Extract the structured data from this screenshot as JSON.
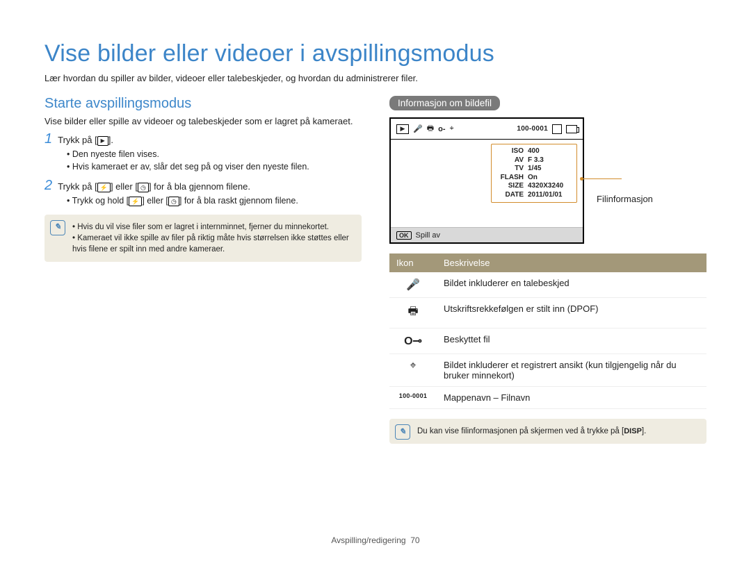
{
  "title": "Vise bilder eller videoer i avspillingsmodus",
  "intro": "Lær hvordan du spiller av bilder, videoer eller talebeskjeder, og hvordan du administrerer filer.",
  "left": {
    "heading": "Starte avspillingsmodus",
    "p1": "Vise bilder eller spille av videoer og talebeskjeder som er lagret på kameraet.",
    "step1_pre": "Trykk på [",
    "step1_post": "].",
    "step1_b1": "Den nyeste filen vises.",
    "step1_b2": "Hvis kameraet er av, slår det seg på og viser den nyeste filen.",
    "step2_pre": "Trykk på [",
    "step2_mid": "] eller [",
    "step2_post": "] for å bla gjennom filene.",
    "step2_sub_pre": "Trykk og hold [",
    "step2_sub_mid": "] eller [",
    "step2_sub_post": "] for å bla raskt gjennom filene.",
    "note1": "Hvis du vil vise filer som er lagret i internminnet, fjerner du minnekortet.",
    "note2": "Kameraet vil ikke spille av filer på riktig måte hvis størrelsen ikke støttes eller hvis filene er spilt inn med andre kameraer."
  },
  "right": {
    "label": "Informasjon om bildefil",
    "filenum": "100-0001",
    "info_label": "Filinformasjon",
    "info_rows": [
      {
        "k": "ISO",
        "v": "400"
      },
      {
        "k": "AV",
        "v": "F 3.3"
      },
      {
        "k": "TV",
        "v": "1/45"
      },
      {
        "k": "FLASH",
        "v": "On"
      },
      {
        "k": "SIZE",
        "v": "4320X3240"
      },
      {
        "k": "DATE",
        "v": "2011/01/01"
      }
    ],
    "ok_label": "OK",
    "play_label": "Spill av",
    "table_hdr_icon": "Ikon",
    "table_hdr_desc": "Beskrivelse",
    "rows": [
      {
        "icon": "🎤",
        "icon_name": "voice-icon",
        "desc": "Bildet inkluderer en talebeskjed"
      },
      {
        "icon": "🖶",
        "icon_name": "print-icon",
        "desc": "Utskriftsrekkefølgen er stilt inn (DPOF)"
      },
      {
        "icon": "🗝",
        "icon_name": "lock-icon",
        "desc": "Beskyttet fil"
      },
      {
        "icon": "⌖",
        "icon_name": "face-icon",
        "desc": "Bildet inkluderer et registrert ansikt (kun tilgjengelig når du bruker minnekort)"
      },
      {
        "icon": "100-0001",
        "icon_name": "filenum-icon",
        "desc": "Mappenavn – Filnavn"
      }
    ],
    "tip_pre": "Du kan vise filinformasjonen på skjermen ved å trykke på [",
    "tip_tag": "DISP",
    "tip_post": "]."
  },
  "footer": {
    "section": "Avspilling/redigering",
    "page": "70"
  }
}
